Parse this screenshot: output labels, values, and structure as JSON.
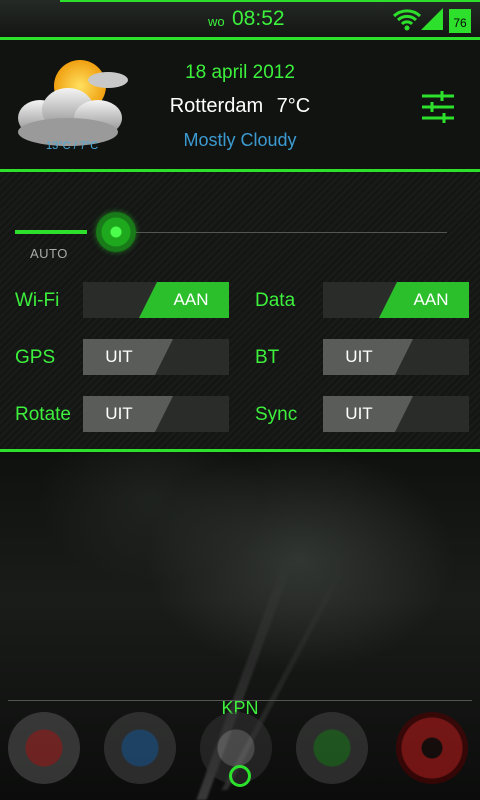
{
  "status_bar": {
    "day": "wo",
    "time": "08:52",
    "battery": "76",
    "wifi_icon": "wifi-icon",
    "signal_icon": "signal-icon"
  },
  "weather": {
    "icon": "partly-cloudy-icon",
    "temp_range": "13°C / 7°C",
    "date": "18 april 2012",
    "city": "Rotterdam",
    "temp": "7°C",
    "condition": "Mostly Cloudy",
    "settings_icon": "sliders-icon"
  },
  "brightness": {
    "auto_label": "AUTO",
    "level": 0.23
  },
  "toggles": [
    {
      "label": "Wi-Fi",
      "state": "AAN"
    },
    {
      "label": "Data",
      "state": "AAN"
    },
    {
      "label": "GPS",
      "state": "UIT"
    },
    {
      "label": "BT",
      "state": "UIT"
    },
    {
      "label": "Rotate",
      "state": "UIT"
    },
    {
      "label": "Sync",
      "state": "UIT"
    }
  ],
  "carrier": "KPN",
  "dock": [
    {
      "icon": "gmail-icon"
    },
    {
      "icon": "contacts-icon"
    },
    {
      "icon": "camera-icon"
    },
    {
      "icon": "whatsapp-icon"
    },
    {
      "icon": "opera-icon"
    }
  ],
  "colors": {
    "accent": "#2ce02c",
    "info_blue": "#3c9ad0"
  }
}
